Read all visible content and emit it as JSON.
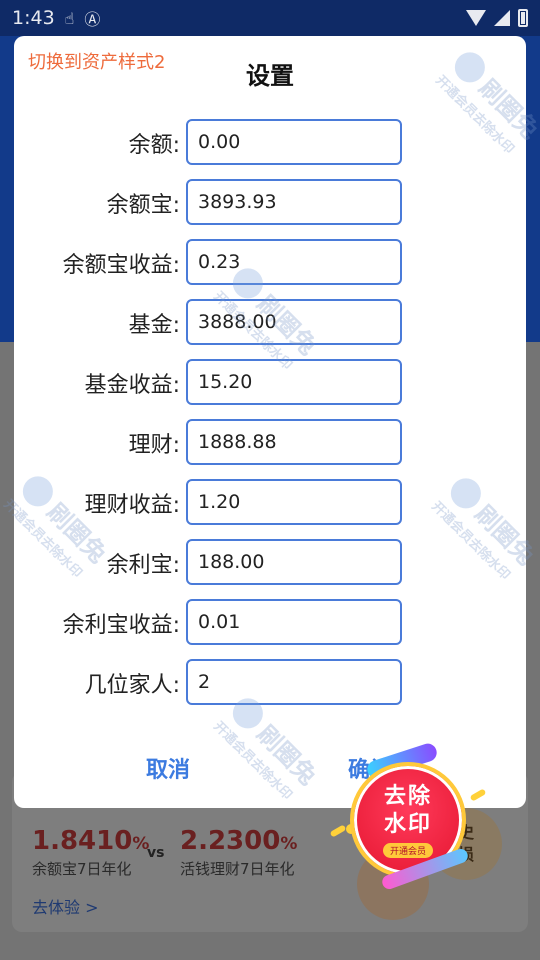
{
  "status_bar": {
    "time": "1:43",
    "notif_icon_1": "touch-icon",
    "notif_icon_2": "a-icon"
  },
  "dialog": {
    "switch_style": "切换到资产样式2",
    "title": "设置",
    "fields": [
      {
        "label": "余额:",
        "value": "0.00"
      },
      {
        "label": "余额宝:",
        "value": "3893.93"
      },
      {
        "label": "余额宝收益:",
        "value": "0.23"
      },
      {
        "label": "基金:",
        "value": "3888.00"
      },
      {
        "label": "基金收益:",
        "value": "15.20"
      },
      {
        "label": "理财:",
        "value": "1888.88"
      },
      {
        "label": "理财收益:",
        "value": "1.20"
      },
      {
        "label": "余利宝:",
        "value": "188.00"
      },
      {
        "label": "余利宝收益:",
        "value": "0.01"
      },
      {
        "label": "几位家人:",
        "value": "2"
      }
    ],
    "cancel": "取消",
    "confirm": "确认"
  },
  "background": {
    "rate1": {
      "value": "1.8410",
      "unit": "%",
      "label": "余额宝7日年化"
    },
    "vs": "vs",
    "rate2": {
      "value": "2.2300",
      "unit": "%",
      "label": "活钱理财7日年化"
    },
    "trial_link": "去体验 >",
    "circle_text": "史\n损"
  },
  "watermark": {
    "brand": "刷圈兔",
    "tagline": "开通会员去除水印"
  },
  "badge": {
    "title_line1": "去除",
    "title_line2": "水印",
    "subtitle": "开通会员"
  }
}
